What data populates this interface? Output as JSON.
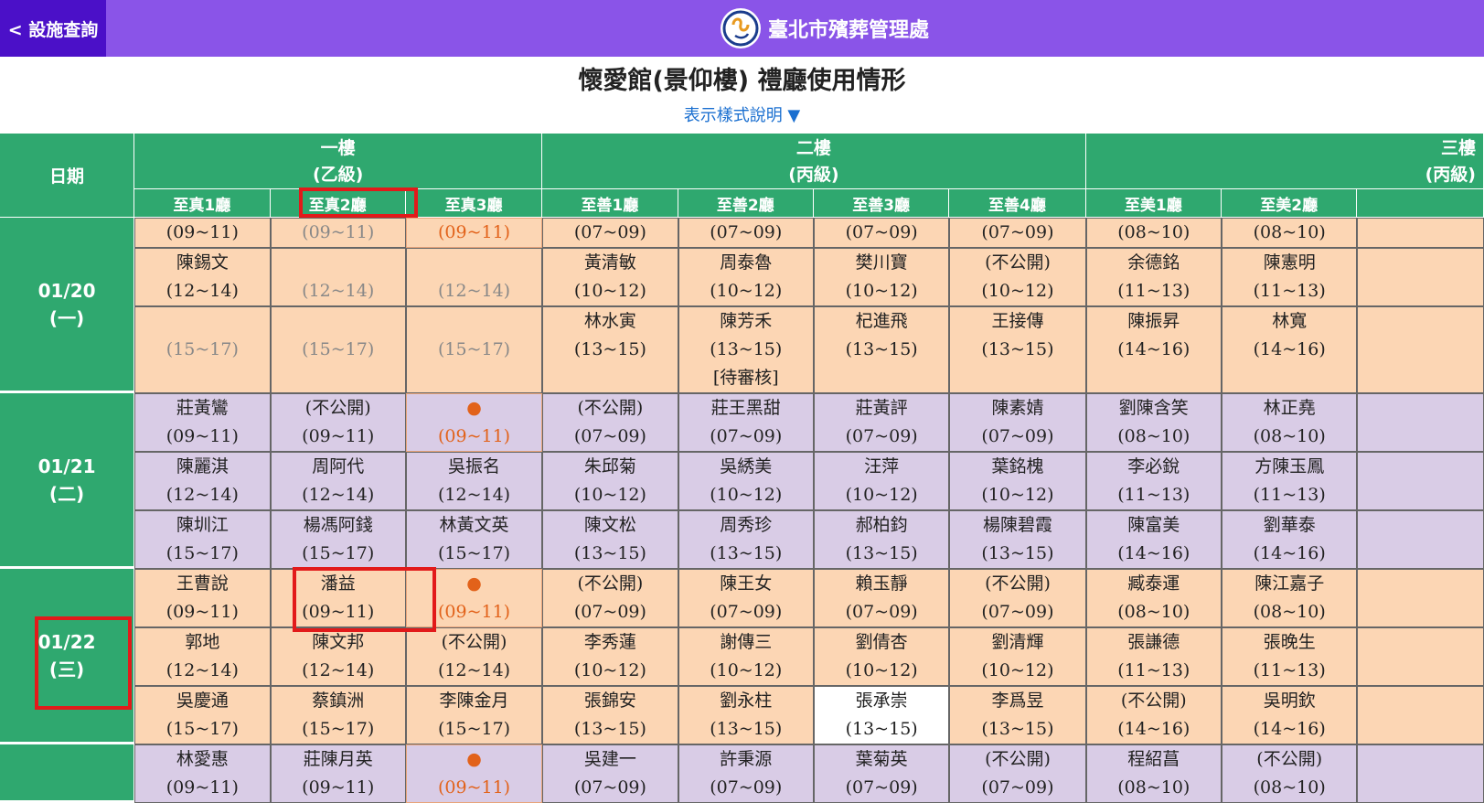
{
  "header": {
    "back_label": "< 設施查詢",
    "brand_name": "臺北市殯葬管理處"
  },
  "page": {
    "title": "懷愛館(景仰樓) 禮廳使用情形",
    "legend_toggle": "表示樣式說明 ▼"
  },
  "table": {
    "date_header": "日期",
    "floors": [
      {
        "name": "一樓",
        "grade": "(乙級)",
        "span": 3
      },
      {
        "name": "二樓",
        "grade": "(丙級)",
        "span": 4
      },
      {
        "name": "三樓",
        "grade": "(丙級)",
        "span": 3
      }
    ],
    "halls": [
      "至真1廳",
      "至真2廳",
      "至真3廳",
      "至善1廳",
      "至善2廳",
      "至善3廳",
      "至善4廳",
      "至美1廳",
      "至美2廳",
      ""
    ],
    "days": [
      {
        "date": "01/20",
        "weekday": "(一)",
        "color": "o",
        "rows": [
          [
            {
              "t": "(09~11)"
            },
            {
              "t": "(09~11)",
              "s": "empty"
            },
            {
              "t": "(09~11)",
              "s": "avail"
            },
            {
              "t": "(07~09)"
            },
            {
              "t": "(07~09)"
            },
            {
              "t": "(07~09)"
            },
            {
              "t": "(07~09)"
            },
            {
              "t": "(08~10)"
            },
            {
              "t": "(08~10)"
            },
            {
              "t": ""
            }
          ],
          [
            {
              "n": "陳錫文",
              "t": "(12~14)"
            },
            {
              "t": "(12~14)",
              "s": "empty"
            },
            {
              "t": "(12~14)",
              "s": "empty"
            },
            {
              "n": "黃清敏",
              "t": "(10~12)"
            },
            {
              "n": "周泰魯",
              "t": "(10~12)"
            },
            {
              "n": "樊川寶",
              "t": "(10~12)"
            },
            {
              "n": "(不公開)",
              "t": "(10~12)"
            },
            {
              "n": "余德銘",
              "t": "(11~13)"
            },
            {
              "n": "陳憲明",
              "t": "(11~13)"
            },
            {
              "t": ""
            }
          ],
          [
            {
              "t": "(15~17)",
              "s": "empty"
            },
            {
              "t": "(15~17)",
              "s": "empty"
            },
            {
              "t": "(15~17)",
              "s": "empty"
            },
            {
              "n": "林水寅",
              "t": "(13~15)"
            },
            {
              "n": "陳芳禾",
              "t": "(13~15)",
              "note": "[待審核]"
            },
            {
              "n": "杞進飛",
              "t": "(13~15)"
            },
            {
              "n": "王接傳",
              "t": "(13~15)"
            },
            {
              "n": "陳振昇",
              "t": "(14~16)"
            },
            {
              "n": "林寬",
              "t": "(14~16)"
            },
            {
              "t": ""
            }
          ]
        ]
      },
      {
        "date": "01/21",
        "weekday": "(二)",
        "color": "p",
        "rows": [
          [
            {
              "n": "莊黃鸞",
              "t": "(09~11)"
            },
            {
              "n": "(不公開)",
              "t": "(09~11)"
            },
            {
              "dot": "●",
              "t": "(09~11)",
              "s": "avail"
            },
            {
              "n": "(不公開)",
              "t": "(07~09)"
            },
            {
              "n": "莊王黑甜",
              "t": "(07~09)"
            },
            {
              "n": "莊黃評",
              "t": "(07~09)"
            },
            {
              "n": "陳素婧",
              "t": "(07~09)"
            },
            {
              "n": "劉陳含笑",
              "t": "(08~10)"
            },
            {
              "n": "林正堯",
              "t": "(08~10)"
            },
            {
              "t": ""
            }
          ],
          [
            {
              "n": "陳麗淇",
              "t": "(12~14)"
            },
            {
              "n": "周阿代",
              "t": "(12~14)"
            },
            {
              "n": "吳振名",
              "t": "(12~14)"
            },
            {
              "n": "朱邱菊",
              "t": "(10~12)"
            },
            {
              "n": "吳綉美",
              "t": "(10~12)"
            },
            {
              "n": "汪萍",
              "t": "(10~12)"
            },
            {
              "n": "葉銘槐",
              "t": "(10~12)"
            },
            {
              "n": "李必銳",
              "t": "(11~13)"
            },
            {
              "n": "方陳玉鳳",
              "t": "(11~13)"
            },
            {
              "t": ""
            }
          ],
          [
            {
              "n": "陳圳江",
              "t": "(15~17)"
            },
            {
              "n": "楊馮阿錢",
              "t": "(15~17)"
            },
            {
              "n": "林黃文英",
              "t": "(15~17)"
            },
            {
              "n": "陳文松",
              "t": "(13~15)"
            },
            {
              "n": "周秀珍",
              "t": "(13~15)"
            },
            {
              "n": "郝柏鈞",
              "t": "(13~15)"
            },
            {
              "n": "楊陳碧霞",
              "t": "(13~15)"
            },
            {
              "n": "陳富美",
              "t": "(14~16)"
            },
            {
              "n": "劉華泰",
              "t": "(14~16)"
            },
            {
              "t": ""
            }
          ]
        ]
      },
      {
        "date": "01/22",
        "weekday": "(三)",
        "color": "o",
        "rows": [
          [
            {
              "n": "王曹說",
              "t": "(09~11)"
            },
            {
              "n": "潘益",
              "t": "(09~11)"
            },
            {
              "dot": "●",
              "t": "(09~11)",
              "s": "avail"
            },
            {
              "n": "(不公開)",
              "t": "(07~09)"
            },
            {
              "n": "陳王女",
              "t": "(07~09)"
            },
            {
              "n": "賴玉靜",
              "t": "(07~09)"
            },
            {
              "n": "(不公開)",
              "t": "(07~09)"
            },
            {
              "n": "臧泰運",
              "t": "(08~10)"
            },
            {
              "n": "陳江嘉子",
              "t": "(08~10)"
            },
            {
              "t": ""
            }
          ],
          [
            {
              "n": "郭地",
              "t": "(12~14)"
            },
            {
              "n": "陳文邦",
              "t": "(12~14)"
            },
            {
              "n": "(不公開)",
              "t": "(12~14)"
            },
            {
              "n": "李秀蓮",
              "t": "(10~12)"
            },
            {
              "n": "謝傳三",
              "t": "(10~12)"
            },
            {
              "n": "劉倩杏",
              "t": "(10~12)"
            },
            {
              "n": "劉清輝",
              "t": "(10~12)"
            },
            {
              "n": "張謙德",
              "t": "(11~13)"
            },
            {
              "n": "張晚生",
              "t": "(11~13)"
            },
            {
              "t": ""
            }
          ],
          [
            {
              "n": "吳慶通",
              "t": "(15~17)"
            },
            {
              "n": "蔡鎮洲",
              "t": "(15~17)"
            },
            {
              "n": "李陳金月",
              "t": "(15~17)"
            },
            {
              "n": "張錦安",
              "t": "(13~15)"
            },
            {
              "n": "劉永柱",
              "t": "(13~15)"
            },
            {
              "n": "張承崇",
              "t": "(13~15)",
              "s": "white"
            },
            {
              "n": "李爲昱",
              "t": "(13~15)"
            },
            {
              "n": "(不公開)",
              "t": "(14~16)"
            },
            {
              "n": "吳明欽",
              "t": "(14~16)"
            },
            {
              "t": ""
            }
          ]
        ]
      },
      {
        "date": "",
        "weekday": "",
        "color": "p",
        "rows": [
          [
            {
              "n": "林愛惠",
              "t": "(09~11)"
            },
            {
              "n": "莊陳月英",
              "t": "(09~11)"
            },
            {
              "dot": "●",
              "t": "(09~11)",
              "s": "avail"
            },
            {
              "n": "吳建一",
              "t": "(07~09)"
            },
            {
              "n": "許秉源",
              "t": "(07~09)"
            },
            {
              "n": "葉菊英",
              "t": "(07~09)"
            },
            {
              "n": "(不公開)",
              "t": "(07~09)"
            },
            {
              "n": "程紹菖",
              "t": "(08~10)"
            },
            {
              "n": "(不公開)",
              "t": "(08~10)"
            },
            {
              "t": ""
            }
          ]
        ]
      }
    ]
  },
  "colors": {
    "topbar": "#8a54e8",
    "back_button": "#4b10c8",
    "table_header": "#2fa86f",
    "orange_cell": "#fcd6b4",
    "purple_cell": "#d9cce6",
    "highlight": "#e21a1a"
  }
}
